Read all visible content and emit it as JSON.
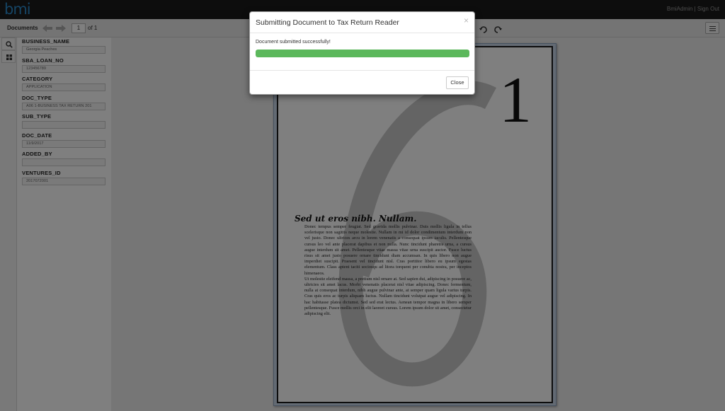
{
  "app": {
    "logo": "bmi",
    "user": "BmiAdmin",
    "separator": "|",
    "signout": "Sign Out"
  },
  "toolbar": {
    "documents_label": "Documents",
    "current_page": "1",
    "page_of": "of 1",
    "icons": {
      "prev": "arrow-left-icon",
      "next": "arrow-right-icon",
      "rotate_left": "rotate-left-icon",
      "rotate_right": "rotate-right-icon",
      "menu": "hamburger-menu-icon"
    }
  },
  "sidebar": {
    "icons": [
      "search-icon",
      "grid-icon"
    ]
  },
  "fields": [
    {
      "label": "BUSINESS_NAME",
      "value": "Georgia Peaches"
    },
    {
      "label": "SBA_LOAN_NO",
      "value": "123456789"
    },
    {
      "label": "CATEGORY",
      "value": "APPLICATION"
    },
    {
      "label": "DOC_TYPE",
      "value": "A06 1-BUSINESS TAX RETURN 201"
    },
    {
      "label": "SUB_TYPE",
      "value": ""
    },
    {
      "label": "DOC_DATE",
      "value": "11/9/2017"
    },
    {
      "label": "ADDED_BY",
      "value": ""
    },
    {
      "label": "VENTURES_ID",
      "value": "2017072001"
    }
  ],
  "document": {
    "page_number": "1",
    "heading": "Sed ut eros nibh. Nullam.",
    "paragraph1": "Donec tempus semper feugiat. Sed gravida mollis pulvinar. Duis mollis ligula in tellus scelerisque non sagittis neque molestie. Nullam in mi id dolor condimentum interdum non vel justo. Donec ultrices arcu in lorem venenatis a consequat ipsum iaculis. Pellentesque cursus leo vel ante placerat dapibus et non nulla. Nunc tincidunt pharetra urna, a cursus augue interdum sit amet. Pellentesque vitae massa vitae urna suscipit auctor. Fusce luctus risus sit amet justo posuere ornare tincidunt diam accumsan. In quis libero non augue imperdiet suscipit. Praesent vel tincidunt nisl. Cras porttitor libero eu ipsum egestas elementum. Class aptent taciti sociosqu ad litora torquent per conubia nostra, per inceptos himenaeos.",
    "paragraph2": "Ut molestie eleifend massa, a pretium nisl ornare at. Sed sapien dui, adipiscing in posuere ac, ultricies sit amet lacus. Morbi venenatis placerat nisl vitae adipiscing. Donec fermentum, nulla at consequat interdum, nibh augue pulvinar ante, at semper quam ligula varius turpis. Cras quis eros ac turpis aliquam luctus. Nullam tincidunt volutpat augue vel adipiscing. In hac habitasse platea dictumst. Sed sed erat lectus. Aenean tempor magna in libero semper pellentesque. Fusce mollis orci in elit laoreet cursus. Lorem ipsum dolor sit amet, consectetur adipiscing elit."
  },
  "modal": {
    "title": "Submitting Document to Tax Return Reader",
    "close_x": "×",
    "message": "Document submitted successfully!",
    "progress_percent": 100,
    "progress_color": "#5cb85c",
    "close_button": "Close"
  }
}
